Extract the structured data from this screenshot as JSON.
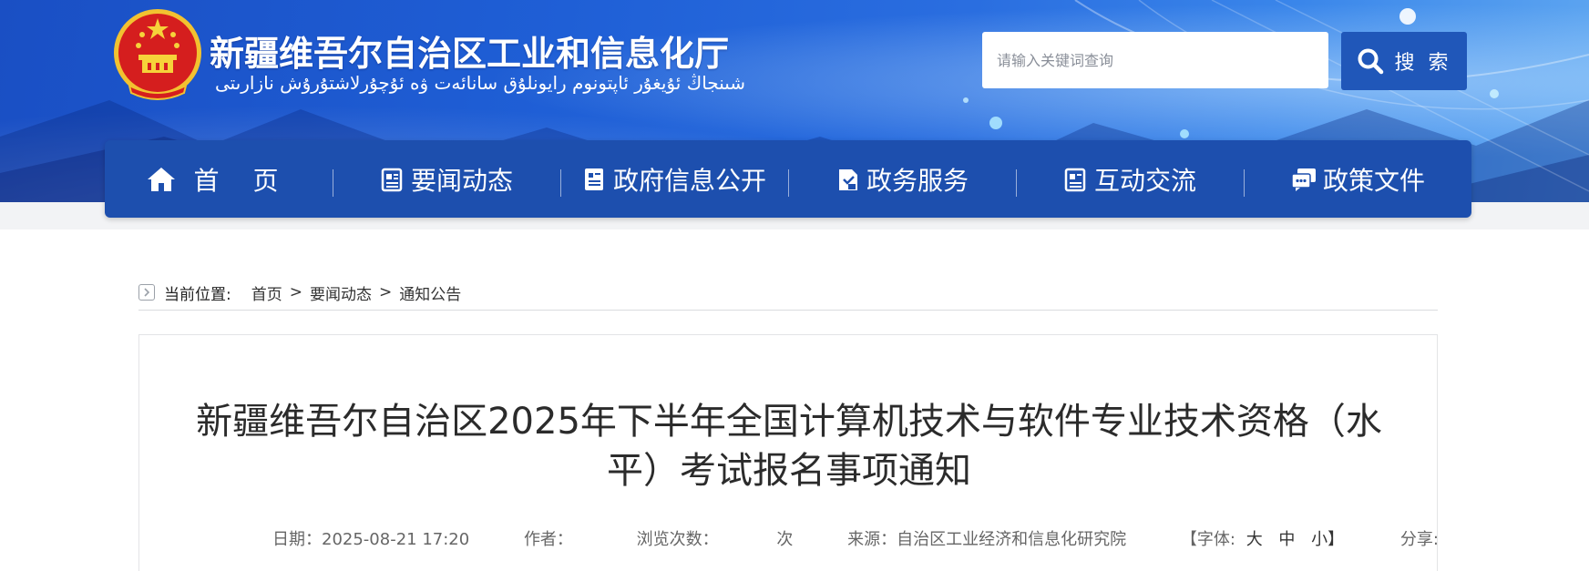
{
  "header": {
    "site_title": "新疆维吾尔自治区工业和信息化厅",
    "site_subtitle": "شىنجاڭ ئۇيغۇر ئاپتونوم رايونلۇق سانائەت ۋە ئۇچۇرلاشتۇرۇش نازارىتى",
    "emblem_icon": "national-emblem-icon"
  },
  "search": {
    "placeholder": "请输入关键词查询",
    "button_label": "搜 索",
    "icon": "search-icon"
  },
  "nav": {
    "items": [
      {
        "label": "首 页",
        "icon": "home-icon"
      },
      {
        "label": "要闻动态",
        "icon": "news-icon"
      },
      {
        "label": "政府信息公开",
        "icon": "document-icon"
      },
      {
        "label": "政务服务",
        "icon": "service-icon"
      },
      {
        "label": "互动交流",
        "icon": "interaction-icon"
      },
      {
        "label": "政策文件",
        "icon": "policy-icon"
      }
    ]
  },
  "breadcrumb": {
    "label": "当前位置:",
    "items": [
      "首页",
      "要闻动态",
      "通知公告"
    ],
    "separator": ">"
  },
  "article": {
    "title": "新疆维吾尔自治区2025年下半年全国计算机技术与软件专业技术资格（水平）考试报名事项通知",
    "date": "日期：2025-08-21 17:20",
    "author": "作者：",
    "views_label": "浏览次数：",
    "views_unit": "次",
    "source": "来源：自治区工业经济和信息化研究院",
    "font_open": "【字体:",
    "font_large": "大",
    "font_medium": "中",
    "font_small": "小】",
    "share": "分享:"
  },
  "colors": {
    "header_blue": "#1f5fd6",
    "nav_blue": "#1d4fae",
    "search_button": "#2057b9"
  }
}
